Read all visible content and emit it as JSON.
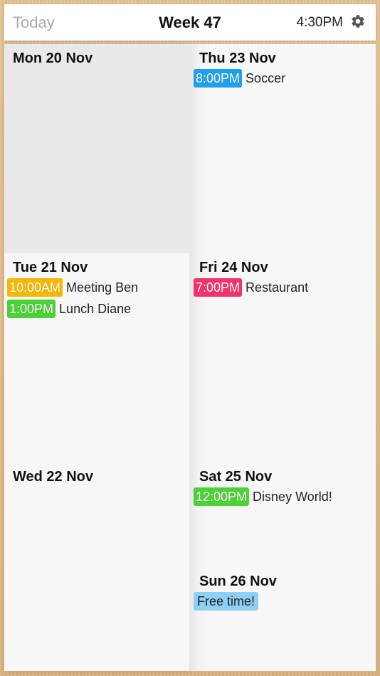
{
  "header": {
    "today_label": "Today",
    "week_label": "Week 47",
    "time": "4:30PM"
  },
  "colors": {
    "yellow": "#f5b800",
    "green": "#4cd137",
    "blue": "#1ea1ee",
    "pink": "#f2336b",
    "light_blue": "#8ed0f5"
  },
  "days": {
    "mon": {
      "title": "Mon 20 Nov",
      "events": []
    },
    "tue": {
      "title": "Tue 21 Nov",
      "events": [
        {
          "time": "10:00AM",
          "title": "Meeting Ben",
          "color": "#f5b800"
        },
        {
          "time": "1:00PM",
          "title": "Lunch Diane",
          "color": "#4cd137"
        }
      ]
    },
    "wed": {
      "title": "Wed 22 Nov",
      "events": []
    },
    "thu": {
      "title": "Thu 23 Nov",
      "events": [
        {
          "time": "8:00PM",
          "title": "Soccer",
          "color": "#1ea1ee"
        }
      ]
    },
    "fri": {
      "title": "Fri 24 Nov",
      "events": [
        {
          "time": "7:00PM",
          "title": "Restaurant",
          "color": "#f2336b"
        }
      ]
    },
    "sat": {
      "title": "Sat 25 Nov",
      "events": [
        {
          "time": "12:00PM",
          "title": "Disney World!",
          "color": "#4cd137"
        }
      ]
    },
    "sun": {
      "title": "Sun 26 Nov",
      "events": [
        {
          "title": "Free time!",
          "color": "#8ed0f5"
        }
      ]
    }
  }
}
